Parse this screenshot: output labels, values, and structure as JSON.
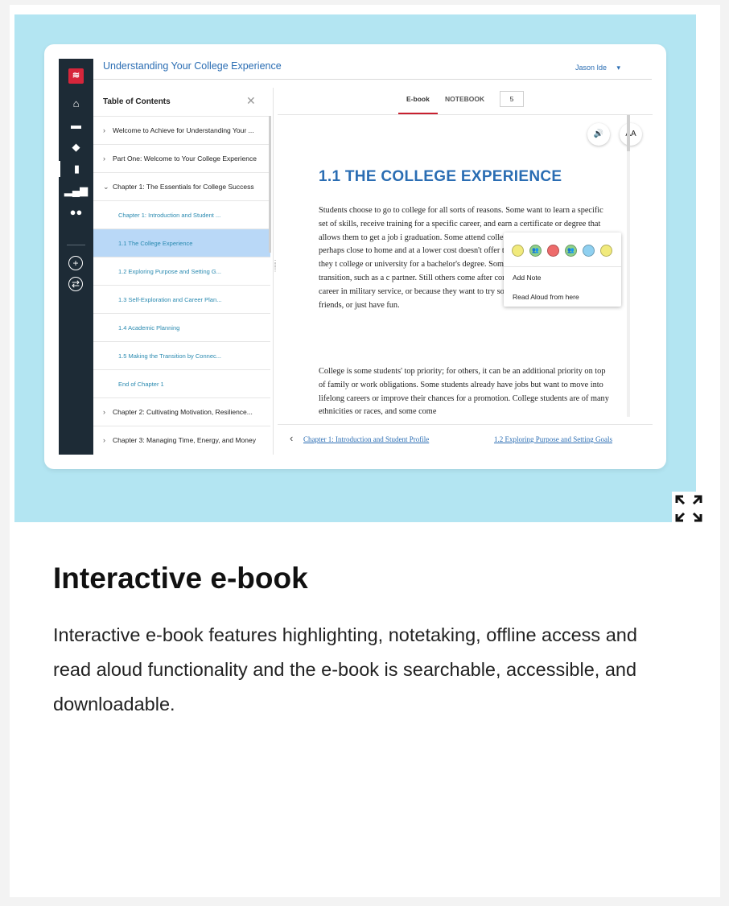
{
  "app": {
    "title": "Understanding Your College Experience",
    "user": "Jason Ide",
    "user_caret": "▾",
    "logo_glyph": "≋"
  },
  "rail": {
    "icons": [
      "home-icon",
      "folder-icon",
      "layers-icon",
      "ebook-icon",
      "chart-icon",
      "people-icon",
      "add-icon",
      "swap-icon"
    ]
  },
  "toc": {
    "heading": "Table of Contents",
    "close": "✕",
    "items": [
      {
        "label": "Welcome to Achieve for Understanding Your ...",
        "type": "section",
        "chev": "›"
      },
      {
        "label": "Part One: Welcome to Your College Experience",
        "type": "section",
        "chev": "›"
      },
      {
        "label": "Chapter 1: The Essentials for College Success",
        "type": "section",
        "chev": "⌄"
      },
      {
        "label": "Chapter 1: Introduction and Student ...",
        "type": "sub"
      },
      {
        "label": "1.1 The College Experience",
        "type": "sub",
        "active": true
      },
      {
        "label": "1.2 Exploring Purpose and Setting G...",
        "type": "sub"
      },
      {
        "label": "1.3 Self-Exploration and Career Plan...",
        "type": "sub"
      },
      {
        "label": "1.4 Academic Planning",
        "type": "sub"
      },
      {
        "label": "1.5 Making the Transition by Connec...",
        "type": "sub"
      },
      {
        "label": "End of Chapter 1",
        "type": "sub"
      },
      {
        "label": "Chapter 2: Cultivating Motivation, Resilience...",
        "type": "section",
        "chev": "›"
      },
      {
        "label": "Chapter 3: Managing Time, Energy, and Money",
        "type": "section",
        "chev": "›"
      }
    ]
  },
  "reader": {
    "tab_ebook": "E-book",
    "tab_notebook": "NOTEBOOK",
    "page_number": "5",
    "audio_glyph": "🔊",
    "text_size_glyph": "AA",
    "chapter_title": "1.1 THE COLLEGE EXPERIENCE",
    "para1": "Students choose to go to college for all sorts of reasons. Some want to learn a specific set of skills, receive training for a specific career, and earn a certificate or degree that allows them to get a job i graduation. Some attend college to earn credits or degree, perhaps close to home and at a lower cost doesn't offer the degree they wish to obtain, they t college or university for a bachelor's degree. Some major life event or personal transition, such as a c partner. Still others come after completing a tour of duty or a career in military service, or because they want to try something different, make new friends, or just have fun.",
    "para2": "College is some students' top priority; for others, it can be an additional priority on top of family or work obligations. Some students already have jobs but want to move into lifelong careers or improve their chances for a promotion. College students are of many ethnicities or races, and some come",
    "popup": {
      "dots": [
        {
          "color": "#f1ea7c",
          "glyph": ""
        },
        {
          "color": "#8fd18a",
          "glyph": "👥"
        },
        {
          "color": "#ee6b6b",
          "glyph": ""
        },
        {
          "color": "#8fd18a",
          "glyph": "👥"
        },
        {
          "color": "#8fd0f0",
          "glyph": ""
        },
        {
          "color": "#f1ea7c",
          "glyph": ""
        }
      ],
      "add_note": "Add Note",
      "read_aloud": "Read Aloud from here"
    },
    "prev_link": "Chapter 1: Introduction and Student Profile",
    "next_link": "1.2 Exploring Purpose and Setting Goals",
    "back_glyph": "‹"
  },
  "card": {
    "heading": "Interactive e-book",
    "description": "Interactive e-book features highlighting, notetaking, offline access and read aloud functionality and the e-book is searchable, accessible, and downloadable.",
    "hero_bg": "#b3e5f2"
  }
}
